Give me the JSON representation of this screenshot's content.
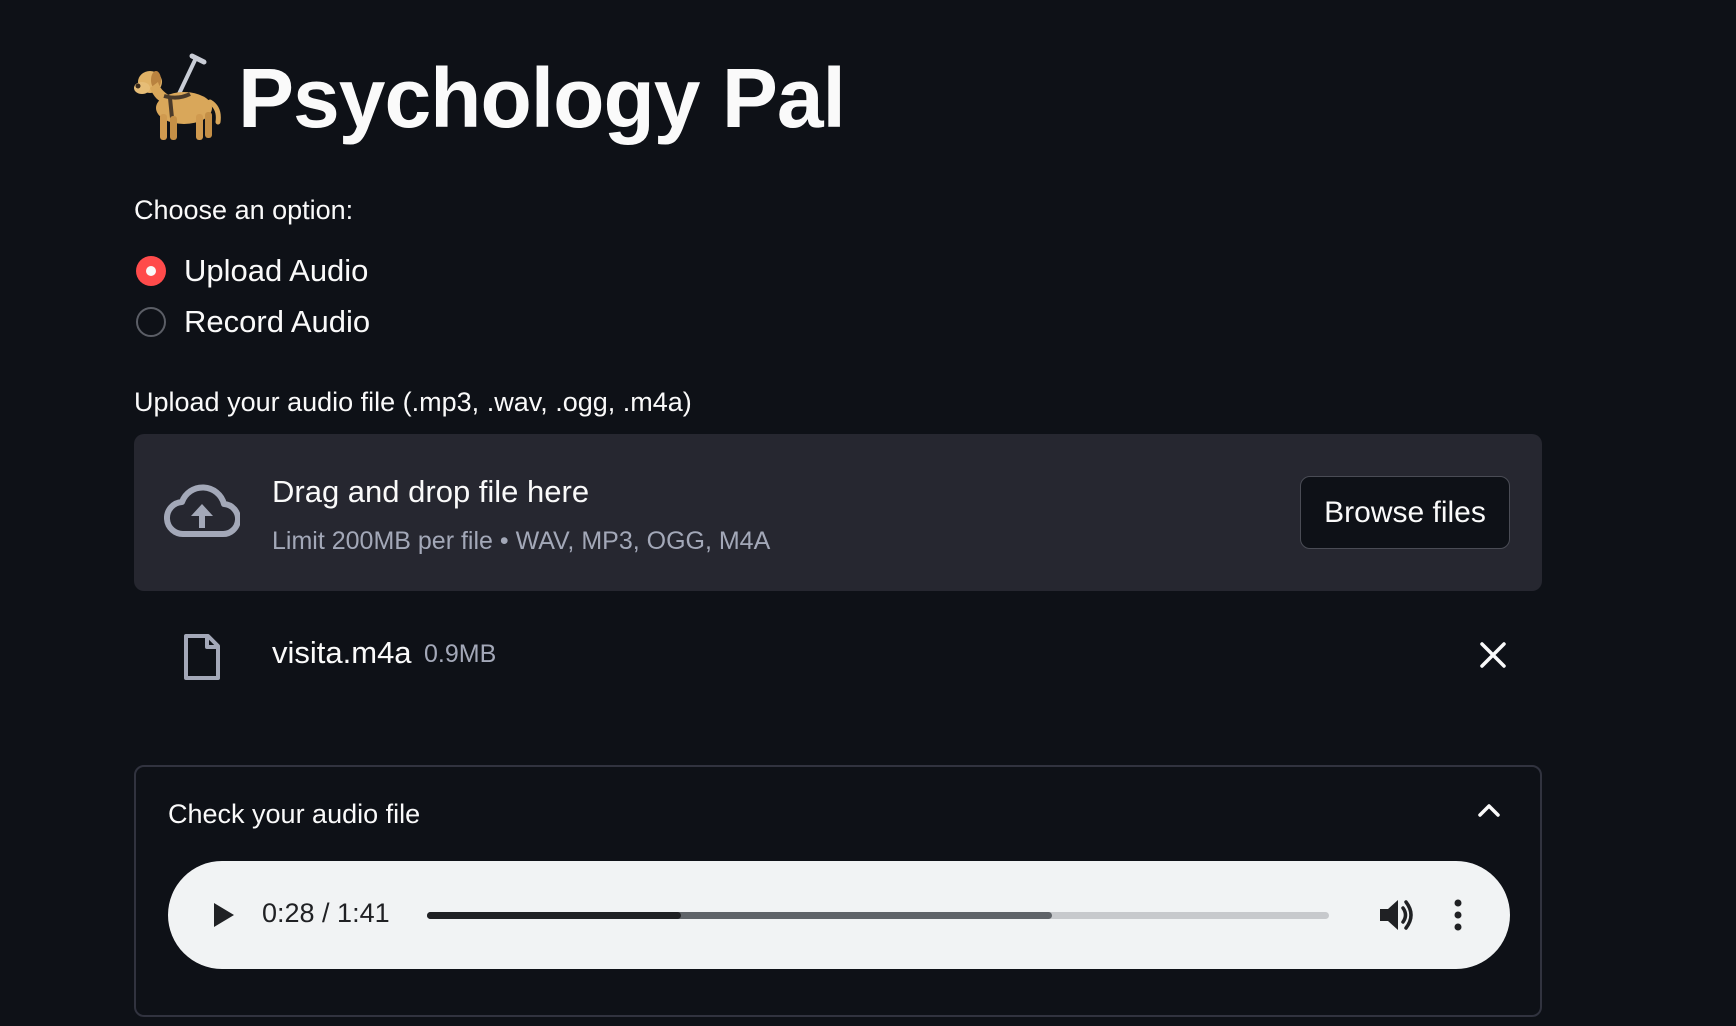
{
  "app": {
    "title": "Psychology Pal",
    "title_icon": "guide-dog-emoji"
  },
  "radio_group": {
    "label": "Choose an option:",
    "options": [
      {
        "label": "Upload Audio",
        "checked": true
      },
      {
        "label": "Record Audio",
        "checked": false
      }
    ],
    "accent_color": "#ff4b4b"
  },
  "uploader": {
    "label": "Upload your audio file (.mp3, .wav, .ogg, .m4a)",
    "drop_text": "Drag and drop file here",
    "limit_text": "Limit 200MB per file • WAV, MP3, OGG, M4A",
    "browse_label": "Browse files",
    "icon": "cloud-upload-icon"
  },
  "uploaded_file": {
    "name": "visita.m4a",
    "size": "0.9MB",
    "icon": "file-icon",
    "remove_icon": "close-icon"
  },
  "expander": {
    "title": "Check your audio file",
    "expanded": true,
    "icon": "chevron-up-icon"
  },
  "audio_player": {
    "time_text": "0:28 / 1:41",
    "played_fraction": 0.282,
    "buffered_fraction": 0.693,
    "play_icon": "play-icon",
    "volume_icon": "volume-icon",
    "menu_icon": "more-vertical-icon"
  },
  "colors": {
    "background": "#0e1117",
    "surface": "#262730",
    "text": "#fafafa",
    "muted_text": "#a3a8b8",
    "player_bg": "#f1f3f4"
  }
}
